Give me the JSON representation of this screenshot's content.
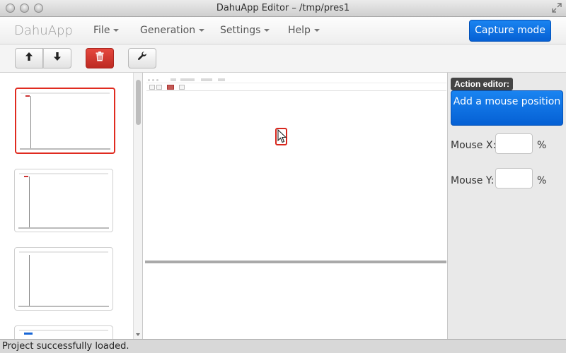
{
  "window": {
    "title": "DahuApp Editor – /tmp/pres1"
  },
  "navbar": {
    "brand": "DahuApp",
    "menus": [
      {
        "label": "File"
      },
      {
        "label": "Generation"
      },
      {
        "label": "Settings"
      },
      {
        "label": "Help"
      }
    ],
    "capture_label": "Capture mode",
    "accent_color": "#0a6ce0"
  },
  "toolbar": {
    "buttons": [
      {
        "icon": "arrow-up-icon"
      },
      {
        "icon": "arrow-down-icon"
      },
      {
        "icon": "trash-icon",
        "color": "#d13a31"
      },
      {
        "icon": "wrench-icon"
      }
    ]
  },
  "sidebar": {
    "thumbnails": [
      {
        "selected": true
      },
      {
        "selected": false
      },
      {
        "selected": false
      },
      {
        "selected": false
      }
    ]
  },
  "preview": {
    "cursor_icon": "mouse-pointer-icon"
  },
  "action_editor": {
    "title": "Action editor:",
    "add_mouse_label": "Add a mouse position",
    "mouse_x_label": "Mouse X:",
    "mouse_x_value": "",
    "mouse_y_label": "Mouse Y:",
    "mouse_y_value": "",
    "unit": "%"
  },
  "status": {
    "text": "Project successfully loaded."
  }
}
